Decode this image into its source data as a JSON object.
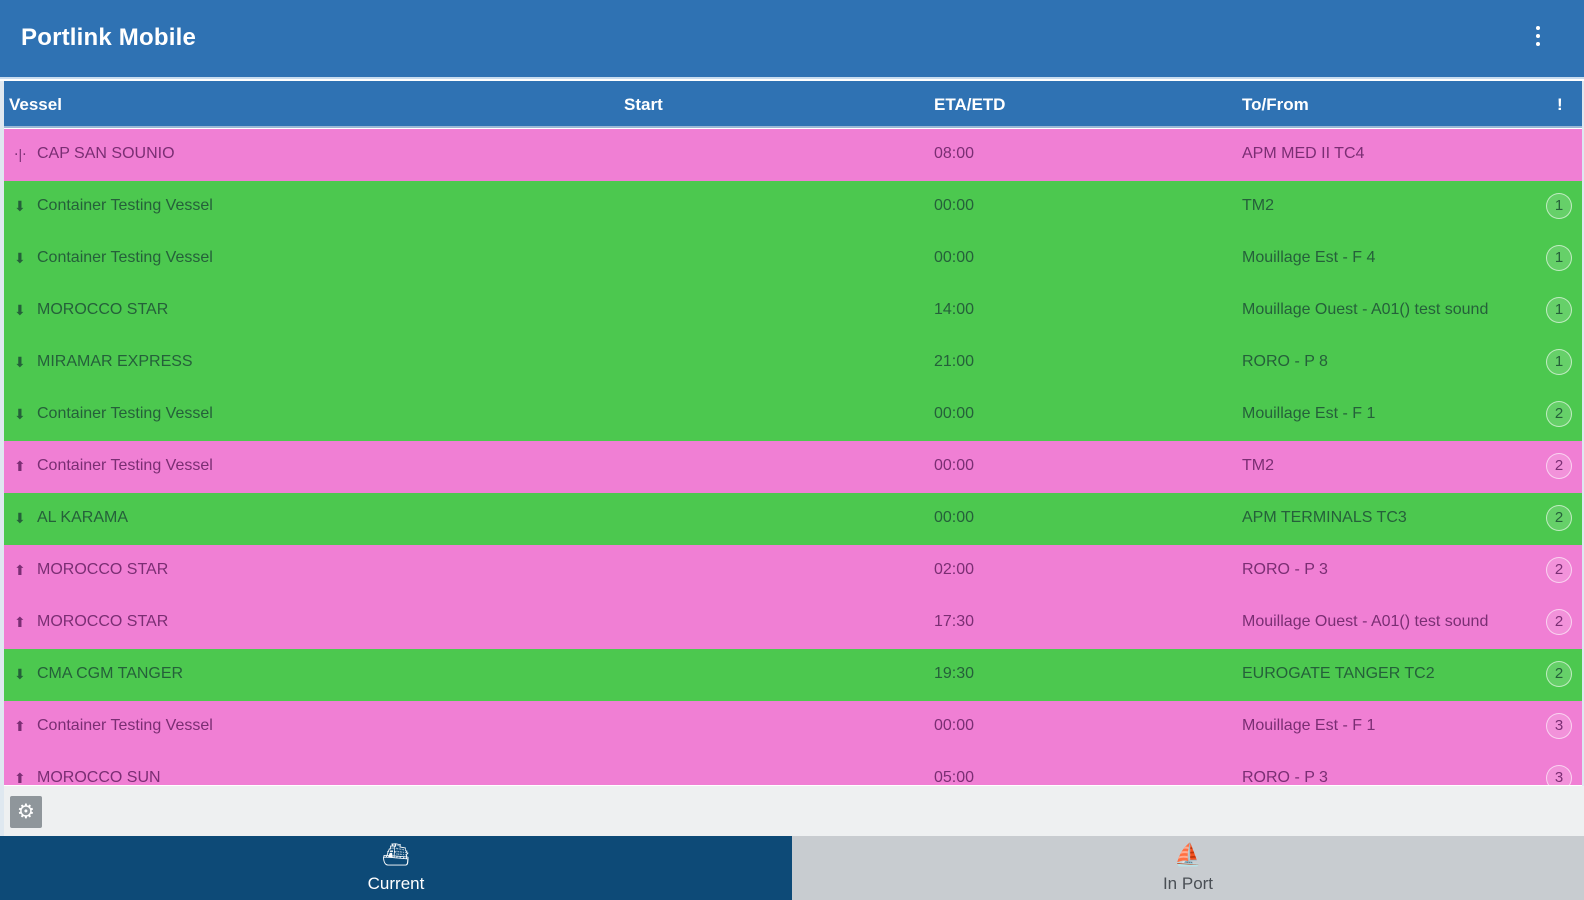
{
  "app": {
    "title": "Portlink Mobile",
    "menu_icon": "more-vert-icon"
  },
  "columns": {
    "vessel": "Vessel",
    "start": "Start",
    "eta": "ETA/ETD",
    "tofrom": "To/From",
    "alert": "!"
  },
  "colors": {
    "header": "#2f72b3",
    "green_row": "#4cc84f",
    "pink_row": "#f07fd4",
    "nav_active": "#0d4a77",
    "nav_inactive": "#c8ccd0"
  },
  "rows": [
    {
      "color": "pink",
      "icon": "shift-icon",
      "vessel": "CAP SAN SOUNIO",
      "eta": "08:00",
      "dest": "APM MED II TC4",
      "count": ""
    },
    {
      "color": "green",
      "icon": "arrival-icon",
      "vessel": "Container Testing Vessel",
      "eta": "00:00",
      "dest": "TM2",
      "count": "1"
    },
    {
      "color": "green",
      "icon": "arrival-icon",
      "vessel": "Container Testing Vessel",
      "eta": "00:00",
      "dest": "Mouillage Est - F 4",
      "count": "1"
    },
    {
      "color": "green",
      "icon": "arrival-icon",
      "vessel": "MOROCCO STAR",
      "eta": "14:00",
      "dest": "Mouillage Ouest - A01() test sound",
      "count": "1"
    },
    {
      "color": "green",
      "icon": "arrival-icon",
      "vessel": "MIRAMAR EXPRESS",
      "eta": "21:00",
      "dest": "RORO - P 8",
      "count": "1"
    },
    {
      "color": "green",
      "icon": "arrival-icon",
      "vessel": "Container Testing Vessel",
      "eta": "00:00",
      "dest": "Mouillage Est - F 1",
      "count": "2"
    },
    {
      "color": "pink",
      "icon": "departure-icon",
      "vessel": "Container Testing Vessel",
      "eta": "00:00",
      "dest": "TM2",
      "count": "2"
    },
    {
      "color": "green",
      "icon": "arrival-icon",
      "vessel": "AL KARAMA",
      "eta": "00:00",
      "dest": "APM TERMINALS TC3",
      "count": "2"
    },
    {
      "color": "pink",
      "icon": "departure-icon",
      "vessel": "MOROCCO STAR",
      "eta": "02:00",
      "dest": "RORO - P 3",
      "count": "2"
    },
    {
      "color": "pink",
      "icon": "departure-icon",
      "vessel": "MOROCCO STAR",
      "eta": "17:30",
      "dest": "Mouillage Ouest - A01() test sound",
      "count": "2"
    },
    {
      "color": "green",
      "icon": "arrival-icon",
      "vessel": "CMA CGM TANGER",
      "eta": "19:30",
      "dest": "EUROGATE TANGER TC2",
      "count": "2"
    },
    {
      "color": "pink",
      "icon": "departure-icon",
      "vessel": "Container Testing Vessel",
      "eta": "00:00",
      "dest": "Mouillage Est - F 1",
      "count": "3"
    },
    {
      "color": "pink",
      "icon": "departure-icon",
      "vessel": "MOROCCO SUN",
      "eta": "05:00",
      "dest": "RORO - P 3",
      "count": "3"
    }
  ],
  "toolbar": {
    "settings_icon": "gear-icon"
  },
  "nav": {
    "current": {
      "label": "Current",
      "icon": "ferry-icon"
    },
    "inport": {
      "label": "In Port",
      "icon": "sailboat-icon"
    }
  }
}
